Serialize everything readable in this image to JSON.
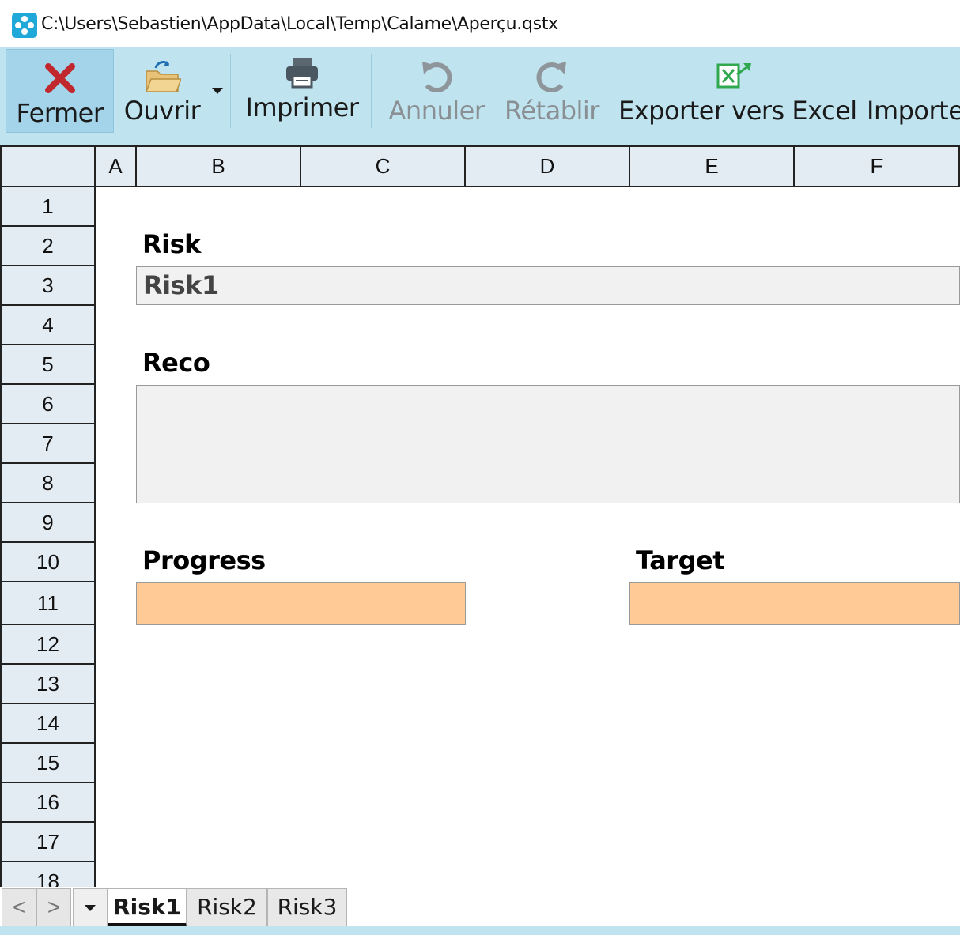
{
  "window": {
    "title": "C:\\Users\\Sebastien\\AppData\\Local\\Temp\\Calame\\Aperçu.qstx"
  },
  "toolbar": {
    "close_label": "Fermer",
    "open_label": "Ouvrir",
    "print_label": "Imprimer",
    "undo_label": "Annuler",
    "redo_label": "Rétablir",
    "export_label": "Exporter vers Excel",
    "import_label": "Importe"
  },
  "grid": {
    "columns": [
      "A",
      "B",
      "C",
      "D",
      "E",
      "F"
    ],
    "rows": [
      "1",
      "2",
      "3",
      "4",
      "5",
      "6",
      "7",
      "8",
      "9",
      "10",
      "11",
      "12",
      "13",
      "14",
      "15",
      "16",
      "17",
      "18"
    ]
  },
  "form": {
    "risk_label": "Risk",
    "risk_value": "Risk1",
    "reco_label": "Reco",
    "reco_value": "",
    "progress_label": "Progress",
    "progress_value": "",
    "target_label": "Target",
    "target_value": ""
  },
  "sheet_tabs": {
    "prev": "<",
    "next": ">",
    "tabs": [
      "Risk1",
      "Risk2",
      "Risk3"
    ],
    "active": "Risk1"
  },
  "colors": {
    "toolbar_bg": "#bfe4ef",
    "header_bg": "#e4ecf3",
    "input_grey": "#f1f1f1",
    "input_orange": "#ffca96",
    "close_red": "#c0282d",
    "excel_green": "#2fa84f"
  },
  "icons": {
    "close": "close-x-icon",
    "open": "open-folder-icon",
    "print": "printer-icon",
    "undo": "undo-arrow-icon",
    "redo": "redo-arrow-icon",
    "export": "excel-export-icon",
    "app": "app-logo-icon"
  }
}
